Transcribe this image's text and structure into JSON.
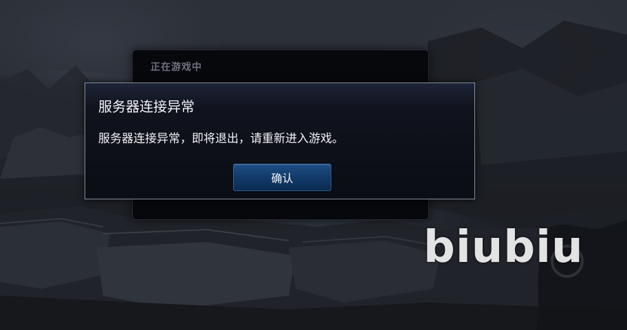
{
  "background_panel": {
    "title": "正在游戏中"
  },
  "dialog": {
    "title": "服务器连接异常",
    "message": "服务器连接异常，即将退出，请重新进入游戏。",
    "confirm_label": "确认"
  },
  "watermark": {
    "text": "biubiu"
  },
  "colors": {
    "dialog_border": "#8a8f9c",
    "button_blue": "#123a68",
    "text": "#f2f3f6"
  }
}
